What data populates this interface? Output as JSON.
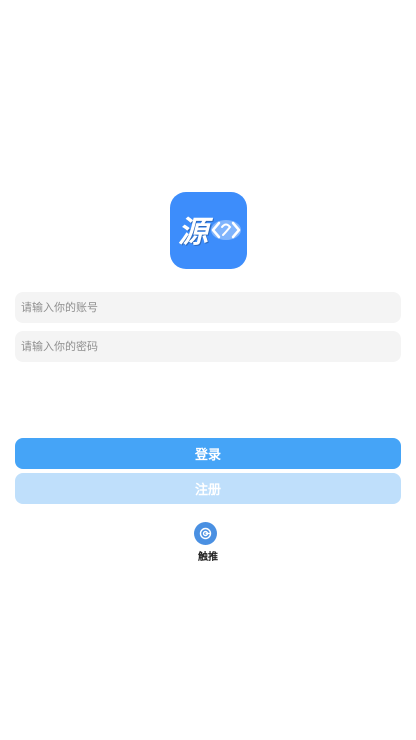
{
  "logo": {
    "text": "源",
    "icon": "source-code-logo",
    "color": "#3d8dfb"
  },
  "form": {
    "account_placeholder": "请输入你的账号",
    "password_placeholder": "请输入你的密码",
    "account_value": "",
    "password_value": ""
  },
  "buttons": {
    "login_label": "登录",
    "register_label": "注册",
    "login_color": "#45a4f7",
    "register_color": "#bfdffb"
  },
  "touch": {
    "label": "触推",
    "icon": "touch-push-icon"
  }
}
